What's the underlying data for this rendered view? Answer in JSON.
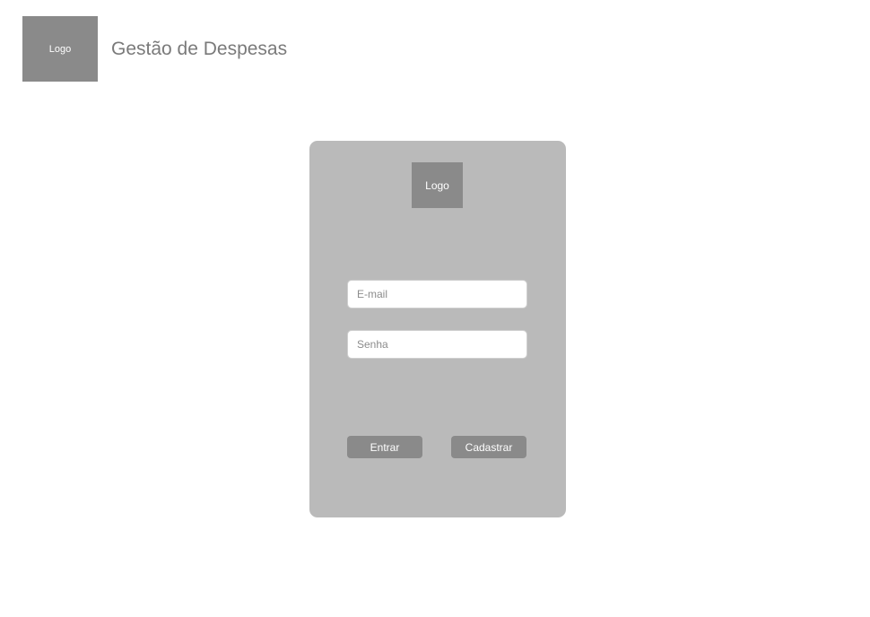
{
  "header": {
    "logo_text": "Logo",
    "title": "Gestão de Despesas"
  },
  "login": {
    "logo_text": "Logo",
    "email": {
      "placeholder": "E-mail",
      "value": ""
    },
    "password": {
      "placeholder": "Senha",
      "value": ""
    },
    "login_button": "Entrar",
    "register_button": "Cadastrar"
  },
  "colors": {
    "background": "#ffffff",
    "card": "#bababa",
    "logo_box": "#8a8a8a",
    "button": "#8a8a8a",
    "title_text": "#7a7a7a"
  }
}
